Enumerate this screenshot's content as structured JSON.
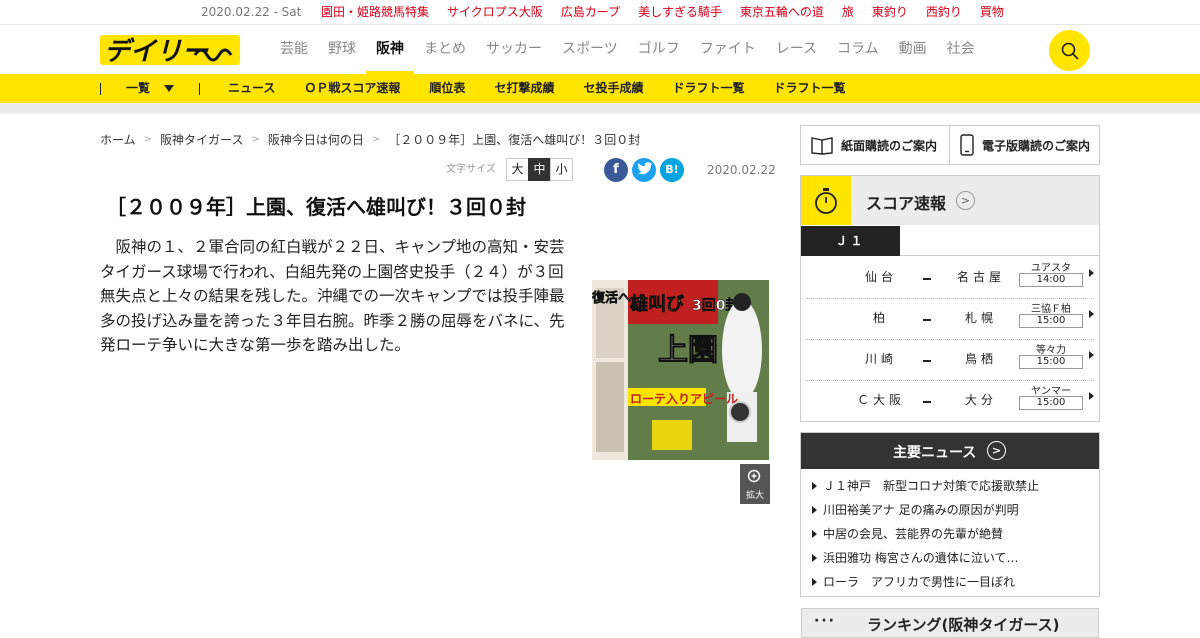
{
  "topbar": {
    "date": "2020.02.22 - Sat",
    "links": [
      "園田・姫路競馬特集",
      "サイクロプス大阪",
      "広島カープ",
      "美しすぎる騎手",
      "東京五輪への道",
      "旅",
      "東釣り",
      "西釣り",
      "買物"
    ]
  },
  "header": {
    "logo_text": "デイリー",
    "nav": [
      "芸能",
      "野球",
      "阪神",
      "まとめ",
      "サッカー",
      "スポーツ",
      "ゴルフ",
      "ファイト",
      "レース",
      "コラム",
      "動画",
      "社会"
    ],
    "active_nav": "阪神"
  },
  "subnav": {
    "list_label": "一覧",
    "items": [
      "ニュース",
      "ＯＰ戦スコア速報",
      "順位表",
      "セ打撃成績",
      "セ投手成績",
      "ドラフト一覧",
      "ドラフト一覧"
    ]
  },
  "breadcrumb": [
    "ホーム",
    "阪神タイガース",
    "阪神今日は何の日",
    "［２００９年］上園、復活へ雄叫び！３回０封"
  ],
  "article": {
    "font_size_label": "文字サイズ",
    "font_sizes": [
      "大",
      "中",
      "小"
    ],
    "selected_font_size": "中",
    "date": "2020.02.22",
    "title": "［２００９年］上園、復活へ雄叫び！３回０封",
    "body": "阪神の１、２軍合同の紅白戦が２２日、キャンプ地の高知・安芸タイガース球場で行われ、白組先発の上園啓史投手（２４）が３回無失点と上々の結果を残した。沖縄での一次キャンプでは投手陣最多の投げ込み量を誇った３年目右腕。昨季２勝の屈辱をバネに、先発ローテ争いに大きな第一歩を踏み出した。",
    "zoom_label": "拡大",
    "share": {
      "facebook": "f",
      "twitter": "t",
      "hatena": "B!"
    },
    "photo_caption_texts": [
      "復活へ",
      "雄叫び",
      "3回0封",
      "上園",
      "ローテ入りアピール"
    ]
  },
  "sidebar": {
    "paper_sub": "紙面購読のご案内",
    "digital_sub": "電子版購読のご案内",
    "score_title": "スコア速報",
    "league_tab": "Ｊ１",
    "matches": [
      {
        "home": "仙台",
        "away": "名古屋",
        "venue": "ユアスタ",
        "time": "14:00"
      },
      {
        "home": "柏",
        "away": "札幌",
        "venue": "三協Ｆ柏",
        "time": "15:00"
      },
      {
        "home": "川崎",
        "away": "鳥栖",
        "venue": "等々力",
        "time": "15:00"
      },
      {
        "home": "Ｃ大阪",
        "away": "大分",
        "venue": "ヤンマー",
        "time": "15:00"
      }
    ],
    "news_title": "主要ニュース",
    "news": [
      "Ｊ１神戸　新型コロナ対策で応援歌禁止",
      "川田裕美アナ 足の痛みの原因が判明",
      "中居の会見、芸能界の先輩が絶賛",
      "浜田雅功 梅宮さんの遺体に泣いて…",
      "ローラ　アフリカで男性に一目ぼれ"
    ],
    "ranking_title": "ランキング(阪神タイガース)"
  },
  "colors": {
    "yellow": "#ffe400",
    "red": "#d7001a",
    "dark": "#333333"
  }
}
